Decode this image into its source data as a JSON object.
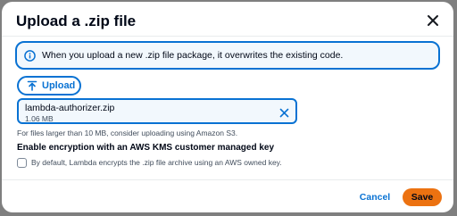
{
  "dialog": {
    "title": "Upload a .zip file",
    "info_message": "When you upload a new .zip file package, it overwrites the existing code.",
    "upload_label": "Upload",
    "file": {
      "name": "lambda-authorizer.zip",
      "size": "1.06 MB"
    },
    "hint": "For files larger than 10 MB, consider uploading using Amazon S3.",
    "encryption": {
      "label": "Enable encryption with an AWS KMS customer managed key",
      "checkbox_text": "By default, Lambda encrypts the .zip file archive using an AWS owned key.",
      "checked": false
    },
    "cancel_label": "Cancel",
    "save_label": "Save"
  },
  "colors": {
    "accent": "#0972d3",
    "primary_button": "#ec7211",
    "info_background": "#f2f8fd",
    "overlay": "#7f7f7f"
  },
  "icons": {
    "close": "close-icon",
    "info": "info-icon",
    "upload": "upload-icon",
    "remove": "remove-file-icon"
  }
}
